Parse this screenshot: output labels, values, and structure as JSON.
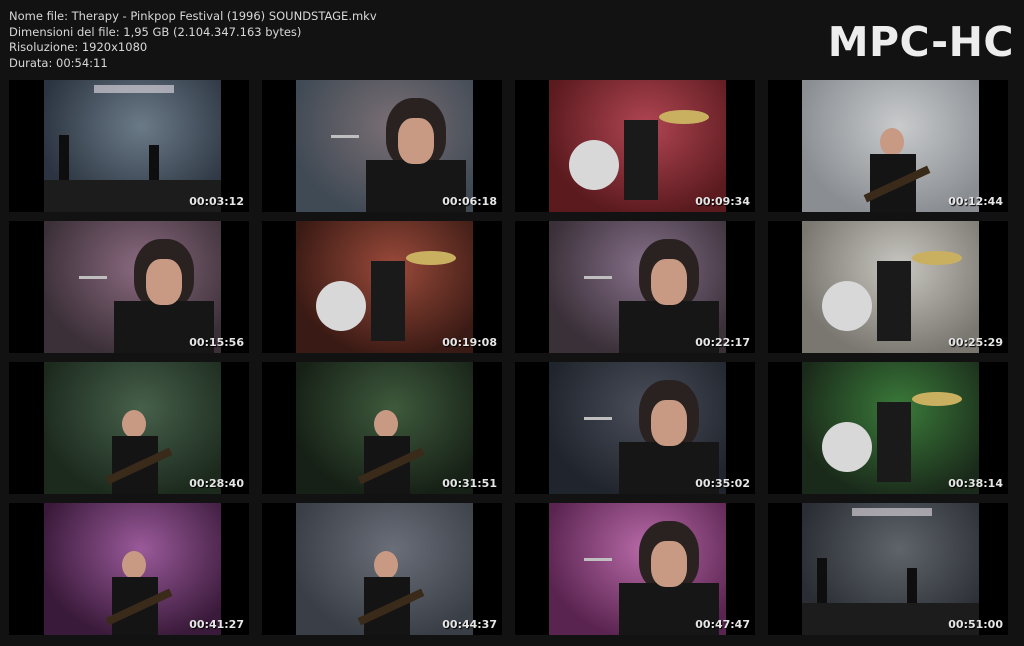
{
  "file_info": {
    "name_line": "Nome file: Therapy - Pinkpop Festival (1996) SOUNDSTAGE.mkv",
    "size_line": "Dimensioni del file: 1,95 GB (2.104.347.163 bytes)",
    "resolution_line": "Risoluzione: 1920x1080",
    "duration_line": "Durata: 00:54:11"
  },
  "brand": {
    "label": "MPC-HC"
  },
  "thumbnails": [
    {
      "time": "00:03:12",
      "scene": "stage-wide",
      "bg1": "#2b3440",
      "bg2": "#6b7a88"
    },
    {
      "time": "00:06:18",
      "scene": "singer-closeup",
      "bg1": "#404a55",
      "bg2": "#7a6f74"
    },
    {
      "time": "00:09:34",
      "scene": "drummer-red",
      "bg1": "#5a1a1e",
      "bg2": "#b04552"
    },
    {
      "time": "00:12:44",
      "scene": "bassist-smoke",
      "bg1": "#8a8e92",
      "bg2": "#c8cacc"
    },
    {
      "time": "00:15:56",
      "scene": "singer-closeup-pink",
      "bg1": "#3c3038",
      "bg2": "#8a6a80"
    },
    {
      "time": "00:19:08",
      "scene": "drumkit-red",
      "bg1": "#3a1a14",
      "bg2": "#9a4a3a"
    },
    {
      "time": "00:22:17",
      "scene": "singer-closeup-pink",
      "bg1": "#3a3038",
      "bg2": "#86708a"
    },
    {
      "time": "00:25:29",
      "scene": "drummer-back",
      "bg1": "#7a7670",
      "bg2": "#c8c6c0"
    },
    {
      "time": "00:28:40",
      "scene": "guitarist-green",
      "bg1": "#1c2a1e",
      "bg2": "#46604a"
    },
    {
      "time": "00:31:51",
      "scene": "guitarist-lights",
      "bg1": "#162016",
      "bg2": "#3e5a3c"
    },
    {
      "time": "00:35:02",
      "scene": "singer-profile",
      "bg1": "#20242c",
      "bg2": "#4a4e5a"
    },
    {
      "time": "00:38:14",
      "scene": "drummer-cymbals",
      "bg1": "#1a2a1a",
      "bg2": "#3a7a3a"
    },
    {
      "time": "00:41:27",
      "scene": "guitarist-purple",
      "bg1": "#3a1a3a",
      "bg2": "#9a5a9a"
    },
    {
      "time": "00:44:37",
      "scene": "guitarist-grey",
      "bg1": "#3a3e46",
      "bg2": "#6a6e78"
    },
    {
      "time": "00:47:47",
      "scene": "singer-profile-pink",
      "bg1": "#5a2450",
      "bg2": "#b86aa8"
    },
    {
      "time": "00:51:00",
      "scene": "stage-wide-grey",
      "bg1": "#2a2e34",
      "bg2": "#5e646a"
    }
  ]
}
